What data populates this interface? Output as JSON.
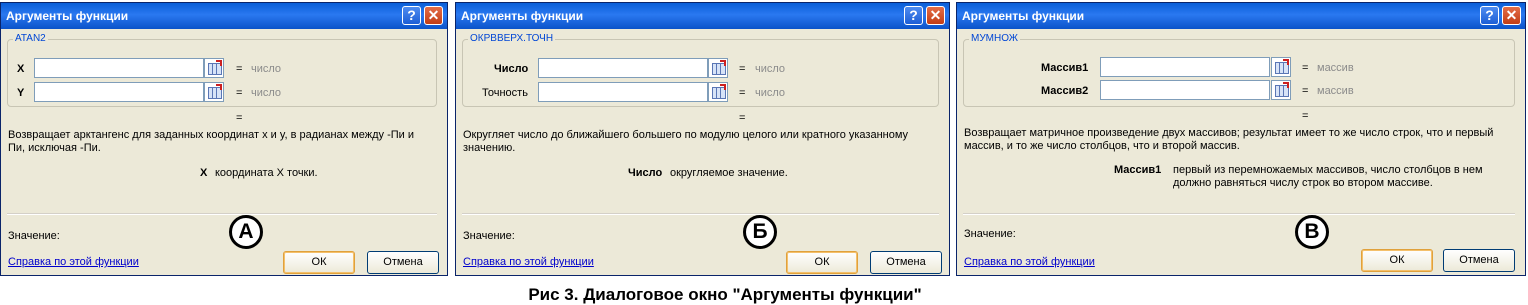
{
  "figure_caption": "Рис 3. Диалоговое окно \"Аргументы функции\"",
  "dialogs": [
    {
      "title": "Аргументы функции",
      "help_button": "?",
      "close_button": "✕",
      "function_name": "ATAN2",
      "args": [
        {
          "label": "X",
          "value": "",
          "result": "число"
        },
        {
          "label": "Y",
          "value": "",
          "result": "число"
        }
      ],
      "eq": "=",
      "result_eq": "=",
      "description": "Возвращает арктангенс для заданных координат x и y, в радианах между -Пи и Пи, исключая -Пи.",
      "arg_help_name": "X",
      "arg_help_text": "координата X точки.",
      "value_label": "Значение:",
      "help_link": "Справка по этой функции",
      "ok": "ОК",
      "cancel": "Отмена",
      "marker": "А"
    },
    {
      "title": "Аргументы функции",
      "help_button": "?",
      "close_button": "✕",
      "function_name": "ОКРВВЕРХ.ТОЧН",
      "args": [
        {
          "label": "Число",
          "value": "",
          "result": "число"
        },
        {
          "label": "Точность",
          "value": "",
          "result": "число"
        }
      ],
      "eq": "=",
      "result_eq": "=",
      "description": "Округляет число до ближайшего большего по модулю целого или кратного указанному значению.",
      "arg_help_name": "Число",
      "arg_help_text": "округляемое значение.",
      "value_label": "Значение:",
      "help_link": "Справка по этой функции",
      "ok": "ОК",
      "cancel": "Отмена",
      "marker": "Б"
    },
    {
      "title": "Аргументы функции",
      "help_button": "?",
      "close_button": "✕",
      "function_name": "МУМНОЖ",
      "args": [
        {
          "label": "Массив1",
          "value": "",
          "result": "массив"
        },
        {
          "label": "Массив2",
          "value": "",
          "result": "массив"
        }
      ],
      "eq": "=",
      "result_eq": "=",
      "description": "Возвращает матричное произведение двух массивов; результат имеет то же число строк, что и первый массив, и то же число столбцов, что и второй массив.",
      "arg_help_name": "Массив1",
      "arg_help_text": "первый из перемножаемых массивов, число столбцов в нем должно равняться числу строк во втором массиве.",
      "value_label": "Значение:",
      "help_link": "Справка по этой функции",
      "ok": "ОК",
      "cancel": "Отмена",
      "marker": "В"
    }
  ]
}
